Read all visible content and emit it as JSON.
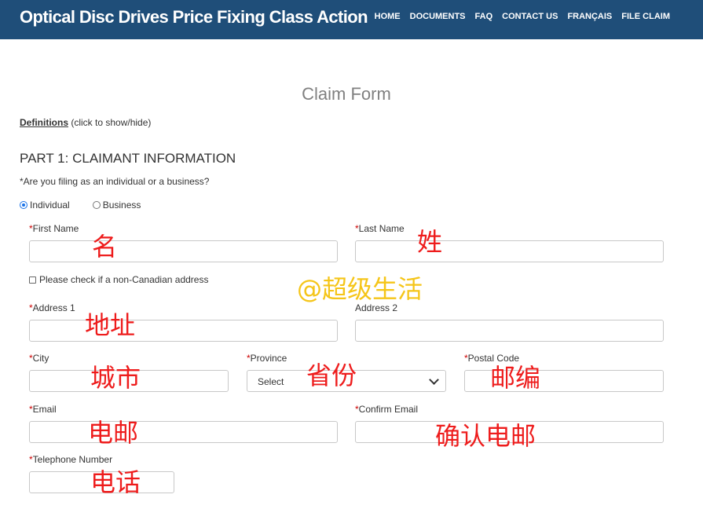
{
  "header": {
    "site_title": "Optical Disc Drives Price Fixing Class Action",
    "nav": [
      "HOME",
      "DOCUMENTS",
      "FAQ",
      "CONTACT US",
      "FRANÇAIS",
      "FILE CLAIM"
    ]
  },
  "form": {
    "title": "Claim Form",
    "definitions_link": "Definitions",
    "definitions_hint": "(click to show/hide)",
    "part_heading": "PART 1: CLAIMANT INFORMATION",
    "filing_question": "*Are you filing as an individual or a business?",
    "filing_options": [
      {
        "label": "Individual",
        "checked": true
      },
      {
        "label": "Business",
        "checked": false
      }
    ],
    "fields": {
      "first_name": "First Name",
      "last_name": "Last Name",
      "non_canadian": "Please check if a non-Canadian address",
      "address1": "Address 1",
      "address2": "Address 2",
      "city": "City",
      "province": "Province",
      "province_value": "Select",
      "postal_code": "Postal Code",
      "email": "Email",
      "confirm_email": "Confirm Email",
      "telephone": "Telephone Number"
    },
    "required_marker": "*"
  },
  "overlay": {
    "watermark": "@超级生活",
    "annotations": {
      "first_name": "名",
      "last_name": "姓",
      "address": "地址",
      "city": "城市",
      "province": "省份",
      "postal_code": "邮编",
      "email": "电邮",
      "confirm_email": "确认电邮",
      "telephone": "电话"
    },
    "annotation_color": "#ee1c1c",
    "watermark_color": "#f5c518"
  },
  "theme": {
    "header_bg": "#1f4e79"
  }
}
